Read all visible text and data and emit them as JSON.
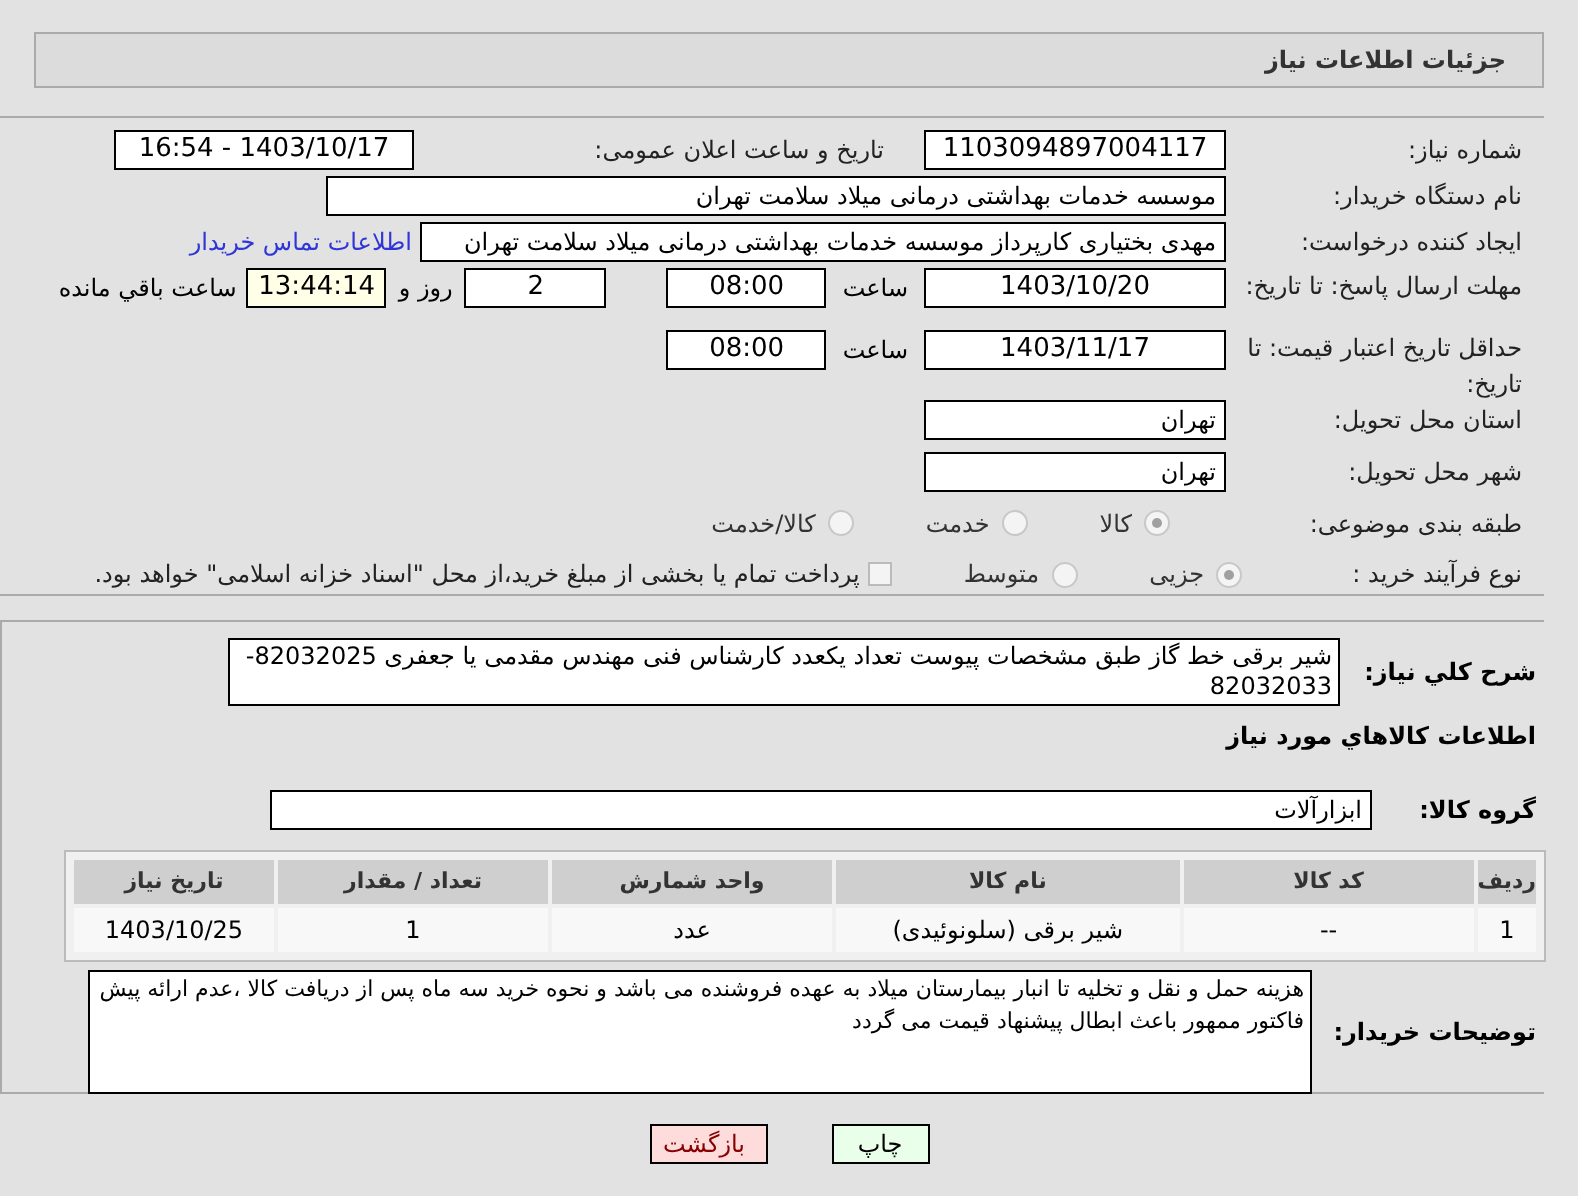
{
  "header": {
    "title": "جزئیات اطلاعات نیاز"
  },
  "need_number": {
    "label": "شماره نیاز:",
    "value": "1103094897004117"
  },
  "announce": {
    "label": "تاریخ و ساعت اعلان عمومی:",
    "value": "1403/10/17 - 16:54"
  },
  "buyer": {
    "label": "نام دستگاه خریدار:",
    "value": "موسسه خدمات بهداشتی درمانی میلاد سلامت تهران"
  },
  "creator": {
    "label": "ایجاد کننده درخواست:",
    "value": "مهدی بختیاری کارپرداز موسسه خدمات بهداشتی درمانی میلاد سلامت تهران",
    "link": "اطلاعات تماس خریدار"
  },
  "reply_deadline": {
    "label": "مهلت ارسال پاسخ: تا تاریخ:",
    "date": "1403/10/20",
    "time_label": "ساعت",
    "time": "08:00",
    "days": "2",
    "days_label": "روز و",
    "remaining": "13:44:14",
    "remaining_label": "ساعت باقي مانده"
  },
  "price_validity": {
    "label": "حداقل تاریخ اعتبار قیمت: تا تاریخ:",
    "date": "1403/11/17",
    "time_label": "ساعت",
    "time": "08:00"
  },
  "province": {
    "label": "استان محل تحویل:",
    "value": "تهران"
  },
  "city": {
    "label": "شهر محل تحویل:",
    "value": "تهران"
  },
  "category": {
    "label": "طبقه بندی موضوعی:",
    "options": [
      {
        "label": "کالا",
        "selected": true
      },
      {
        "label": "خدمت",
        "selected": false
      },
      {
        "label": "کالا/خدمت",
        "selected": false
      }
    ]
  },
  "purchase_type": {
    "label": "نوع فرآیند خرید :",
    "options": [
      {
        "label": "جزیی",
        "selected": true
      },
      {
        "label": "متوسط",
        "selected": false
      }
    ],
    "payment": {
      "label": "پرداخت تمام یا بخشی از مبلغ خرید،از محل \"اسناد خزانه اسلامی\" خواهد بود.",
      "checked": false
    }
  },
  "description": {
    "label": "شرح کلي نياز:",
    "value": "شیر برقی خط گاز طبق مشخصات پیوست تعداد یکعدد کارشناس فنی مهندس مقدمی یا جعفری 82032025-82032033"
  },
  "goods_heading": "اطلاعات کالاهاي مورد نياز",
  "goods_group": {
    "label": "گروه کالا:",
    "value": "ابزارآلات"
  },
  "table": {
    "columns": [
      "ردیف",
      "کد کالا",
      "نام کالا",
      "واحد شمارش",
      "تعداد / مقدار",
      "تاریخ نیاز"
    ],
    "rows": [
      [
        "1",
        "--",
        "شیر برقی (سلونوئیدی)",
        "عدد",
        "1",
        "1403/10/25"
      ]
    ]
  },
  "buyer_notes": {
    "label": "توضیحات خریدار:",
    "value": "هزینه حمل و نقل و تخلیه تا انبار بیمارستان میلاد به عهده فروشنده می باشد و نحوه خرید سه ماه پس از دریافت کالا ،عدم ارائه پیش فاکتور ممهور باعث ابطال پیشنهاد قیمت می گردد"
  },
  "buttons": [
    {
      "label": "چاپ",
      "kind": "print"
    },
    {
      "label": "بازگشت",
      "kind": "back"
    }
  ]
}
